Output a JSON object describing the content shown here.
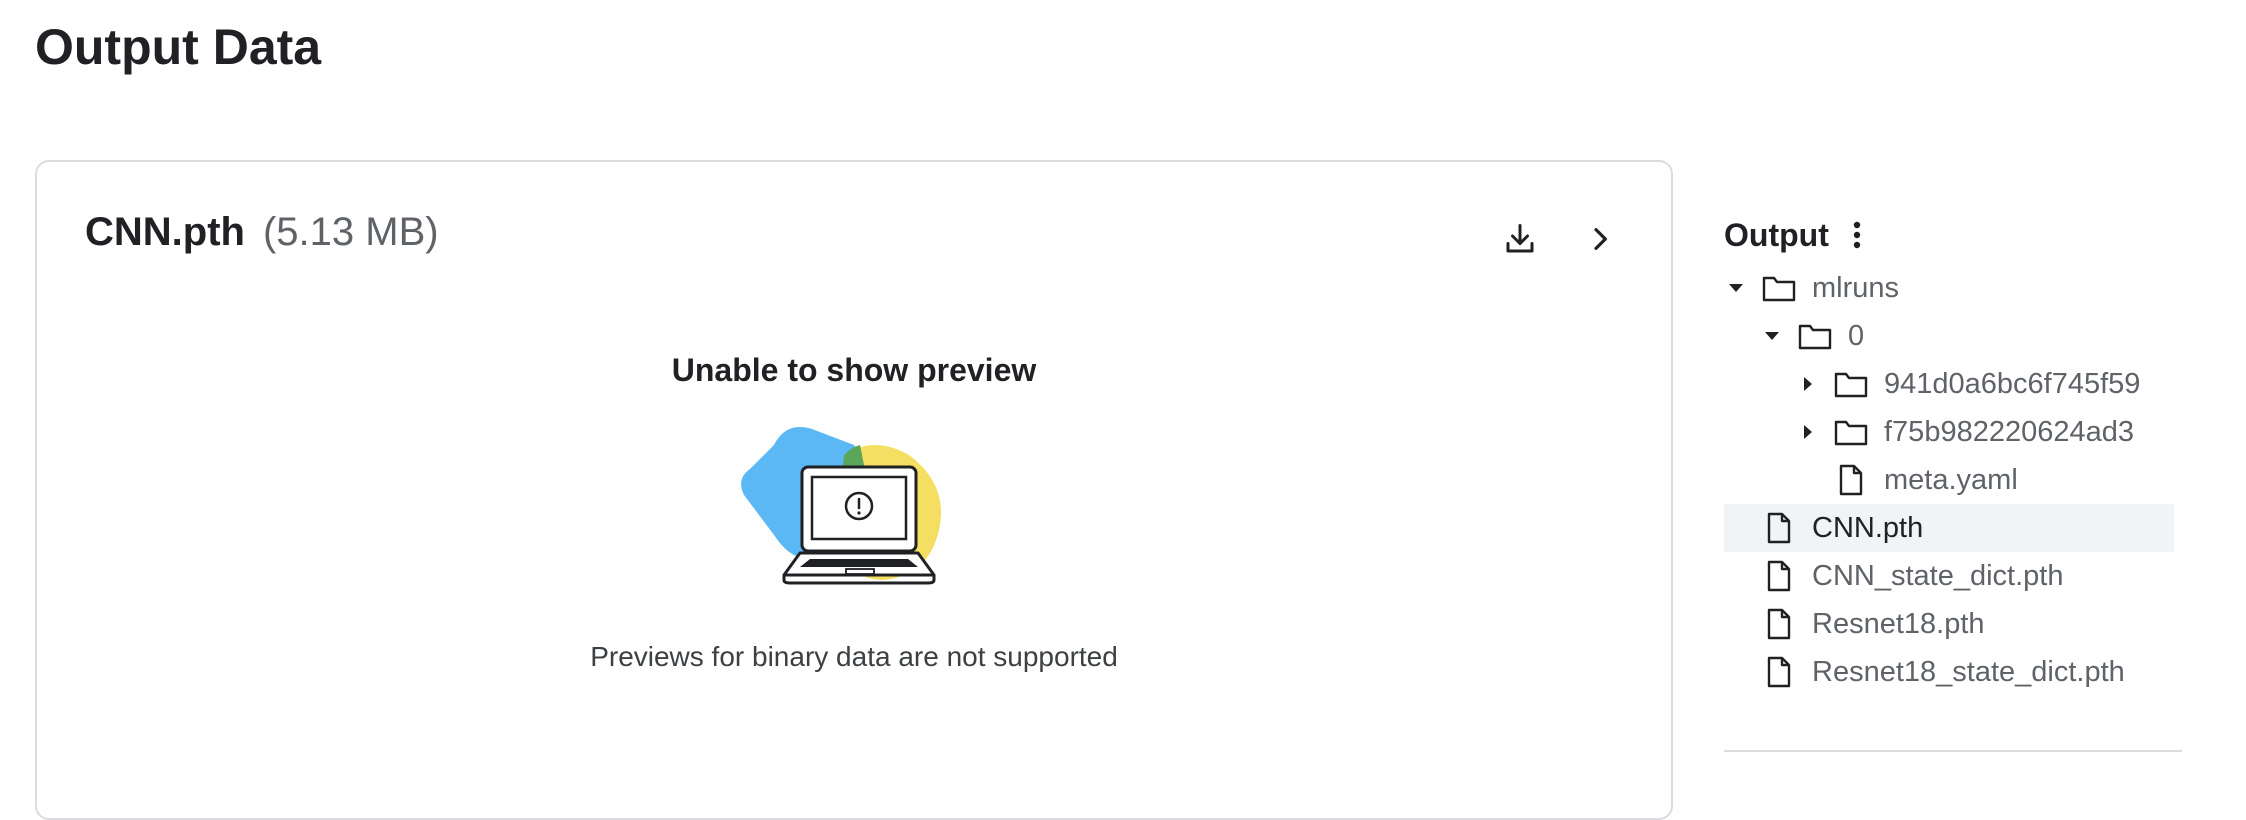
{
  "page": {
    "title": "Output Data"
  },
  "preview_card": {
    "file_name": "CNN.pth",
    "file_size": "(5.13 MB)",
    "preview_title": "Unable to show preview",
    "preview_message": "Previews for binary data are not supported",
    "actions": [
      {
        "icon": "download-icon"
      },
      {
        "icon": "chevron-right-icon"
      }
    ]
  },
  "sidebar": {
    "title": "Output",
    "menu_icon": "more-vert-icon",
    "tree": [
      {
        "label": "mlruns",
        "type": "folder",
        "expanded": true,
        "depth": 0
      },
      {
        "label": "0",
        "type": "folder",
        "expanded": true,
        "depth": 1
      },
      {
        "label": "941d0a6bc6f745f59",
        "type": "folder",
        "expanded": false,
        "depth": 2
      },
      {
        "label": "f75b982220624ad3",
        "type": "folder",
        "expanded": false,
        "depth": 2
      },
      {
        "label": "meta.yaml",
        "type": "file",
        "depth": 2
      },
      {
        "label": "CNN.pth",
        "type": "file",
        "depth": 0,
        "selected": true
      },
      {
        "label": "CNN_state_dict.pth",
        "type": "file",
        "depth": 0
      },
      {
        "label": "Resnet18.pth",
        "type": "file",
        "depth": 0
      },
      {
        "label": "Resnet18_state_dict.pth",
        "type": "file",
        "depth": 0
      }
    ]
  },
  "colors": {
    "selected_row_bg": "#f1f3f4",
    "illustration_blue": "#5bb8f5",
    "illustration_yellow": "#f5df63",
    "illustration_green": "#5aa65a"
  }
}
